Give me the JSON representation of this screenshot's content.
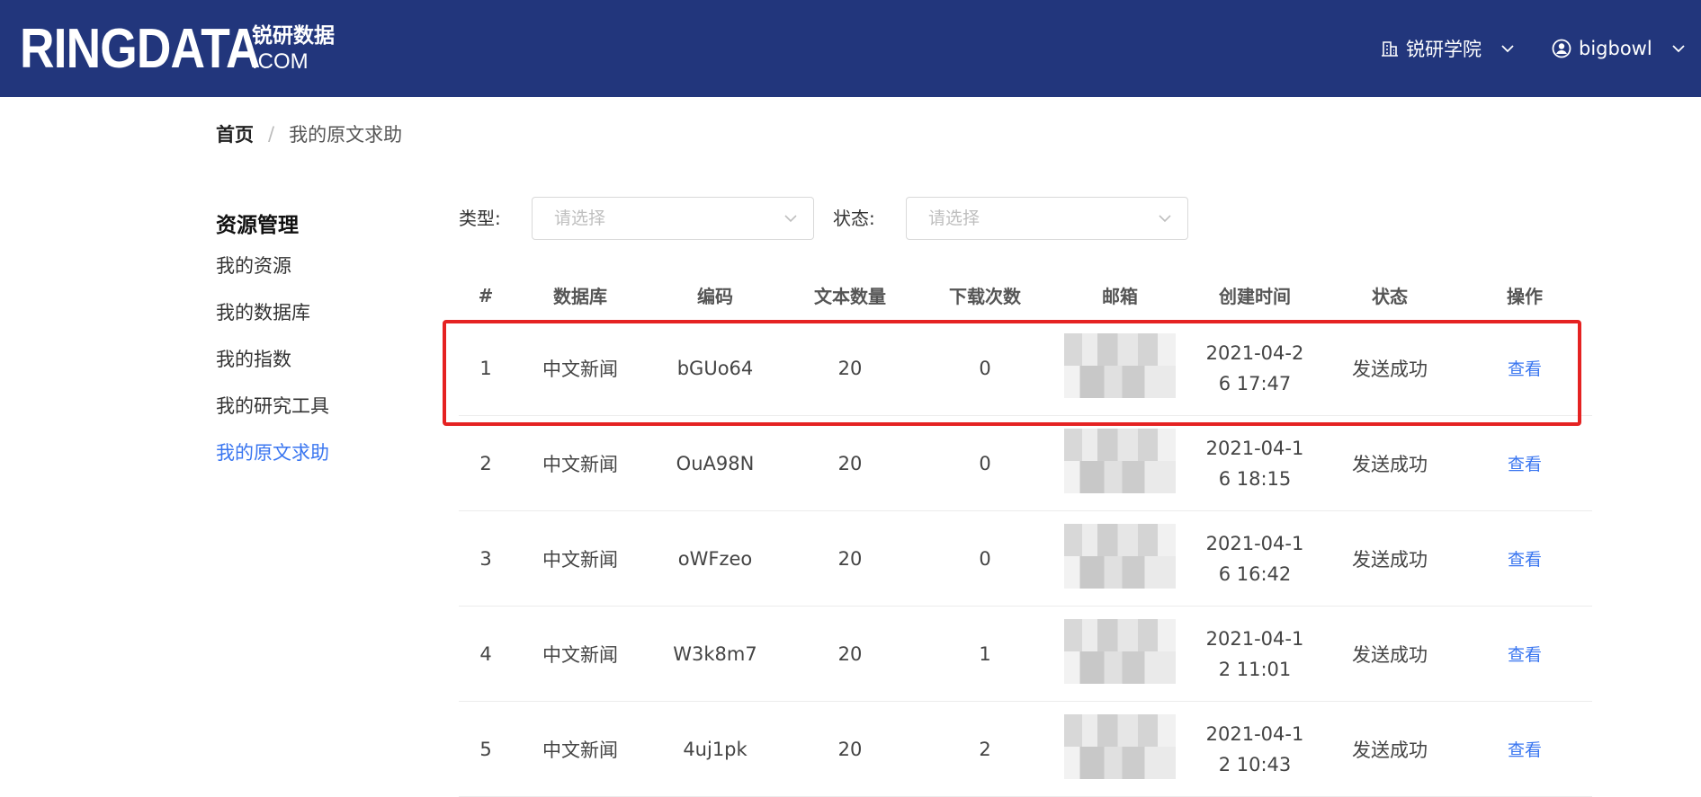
{
  "header": {
    "logo_main": "RINGDATA",
    "logo_cn": "锐研数据",
    "logo_com": ".COM",
    "academy_label": "锐研学院",
    "user_label": "bigbowl"
  },
  "breadcrumb": {
    "home": "首页",
    "separator": "/",
    "current": "我的原文求助"
  },
  "sidebar": {
    "title": "资源管理",
    "items": [
      {
        "label": "我的资源"
      },
      {
        "label": "我的数据库"
      },
      {
        "label": "我的指数"
      },
      {
        "label": "我的研究工具"
      },
      {
        "label": "我的原文求助"
      }
    ]
  },
  "filters": {
    "type_label": "类型:",
    "type_placeholder": "请选择",
    "status_label": "状态:",
    "status_placeholder": "请选择"
  },
  "table": {
    "columns": [
      "#",
      "数据库",
      "编码",
      "文本数量",
      "下载次数",
      "邮箱",
      "创建时间",
      "状态",
      "操作"
    ],
    "rows": [
      {
        "index": "1",
        "database": "中文新闻",
        "code": "bGUo64",
        "text_count": "20",
        "downloads": "0",
        "time_1": "2021-04-2",
        "time_2": "6 17:47",
        "status": "发送成功",
        "action": "查看"
      },
      {
        "index": "2",
        "database": "中文新闻",
        "code": "OuA98N",
        "text_count": "20",
        "downloads": "0",
        "time_1": "2021-04-1",
        "time_2": "6 18:15",
        "status": "发送成功",
        "action": "查看"
      },
      {
        "index": "3",
        "database": "中文新闻",
        "code": "oWFzeo",
        "text_count": "20",
        "downloads": "0",
        "time_1": "2021-04-1",
        "time_2": "6 16:42",
        "status": "发送成功",
        "action": "查看"
      },
      {
        "index": "4",
        "database": "中文新闻",
        "code": "W3k8m7",
        "text_count": "20",
        "downloads": "1",
        "time_1": "2021-04-1",
        "time_2": "2 11:01",
        "status": "发送成功",
        "action": "查看"
      },
      {
        "index": "5",
        "database": "中文新闻",
        "code": "4uj1pk",
        "text_count": "20",
        "downloads": "2",
        "time_1": "2021-04-1",
        "time_2": "2 10:43",
        "status": "发送成功",
        "action": "查看"
      }
    ]
  },
  "colors": {
    "header_bg": "#22367c",
    "accent": "#3a76f0",
    "highlight_border": "#e52222"
  }
}
